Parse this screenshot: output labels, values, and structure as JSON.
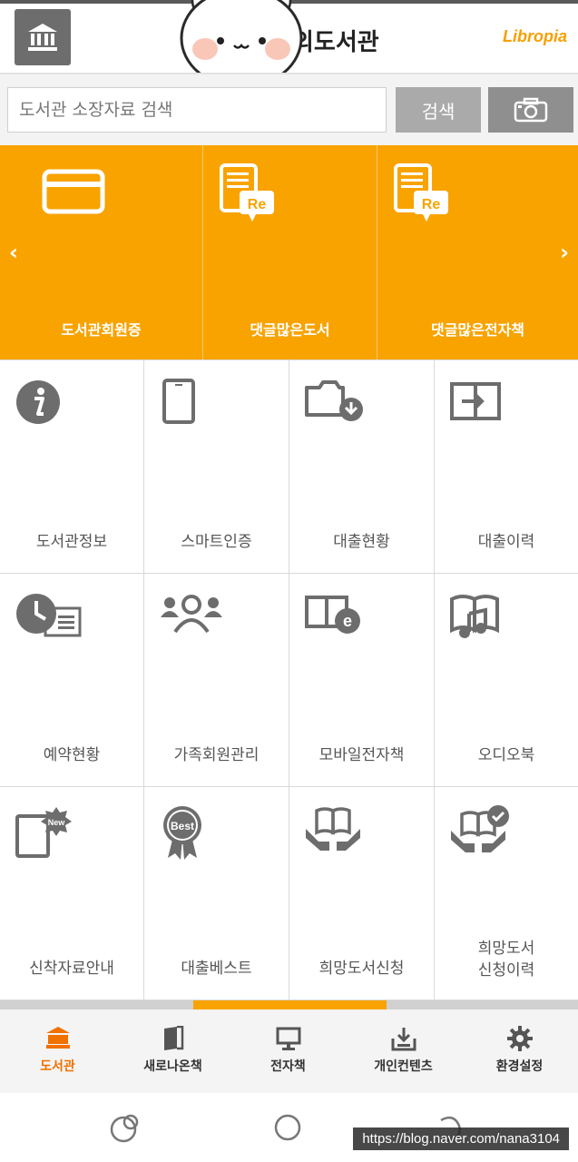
{
  "header": {
    "title": "의도서관",
    "brand": "Libropia",
    "home_icon": "library-building-icon"
  },
  "search": {
    "placeholder": "도서관 소장자료 검색",
    "button_label": "검색",
    "camera_icon": "camera-icon"
  },
  "banner": {
    "color": "#f8a300",
    "slides": [
      {
        "label": "도서관회원증",
        "icon": "member-card-icon"
      },
      {
        "label": "댓글많은도서",
        "icon": "book-reply-icon"
      },
      {
        "label": "댓글많은전자책",
        "icon": "ebook-reply-icon"
      }
    ]
  },
  "menu": [
    {
      "label": "도서관정보",
      "icon": "info-icon"
    },
    {
      "label": "스마트인증",
      "icon": "smartphone-icon"
    },
    {
      "label": "대출현황",
      "icon": "folder-download-icon"
    },
    {
      "label": "대출이력",
      "icon": "arrow-in-box-icon"
    },
    {
      "label": "예약현황",
      "icon": "clock-list-icon"
    },
    {
      "label": "가족회원관리",
      "icon": "family-icon"
    },
    {
      "label": "모바일전자책",
      "icon": "ebook-e-icon"
    },
    {
      "label": "오디오북",
      "icon": "audiobook-icon"
    },
    {
      "label": "신착자료안내",
      "icon": "new-book-icon"
    },
    {
      "label": "대출베스트",
      "icon": "best-badge-icon"
    },
    {
      "label": "희망도서신청",
      "icon": "hands-book-icon"
    },
    {
      "label": "희망도서\n신청이력",
      "icon": "hands-book-check-icon"
    }
  ],
  "page_indicator": {
    "current": 2,
    "total": 3
  },
  "bottom_nav": [
    {
      "label": "도서관",
      "icon": "library-icon",
      "active": true
    },
    {
      "label": "새로나온책",
      "icon": "book-icon",
      "active": false
    },
    {
      "label": "전자책",
      "icon": "monitor-icon",
      "active": false
    },
    {
      "label": "개인컨텐츠",
      "icon": "download-tray-icon",
      "active": false
    },
    {
      "label": "환경설정",
      "icon": "gear-icon",
      "active": false
    }
  ],
  "watermark": "https://blog.naver.com/nana3104",
  "colors": {
    "accent": "#f8a300",
    "active_nav": "#f07000",
    "icon_gray": "#6d6d6d"
  }
}
